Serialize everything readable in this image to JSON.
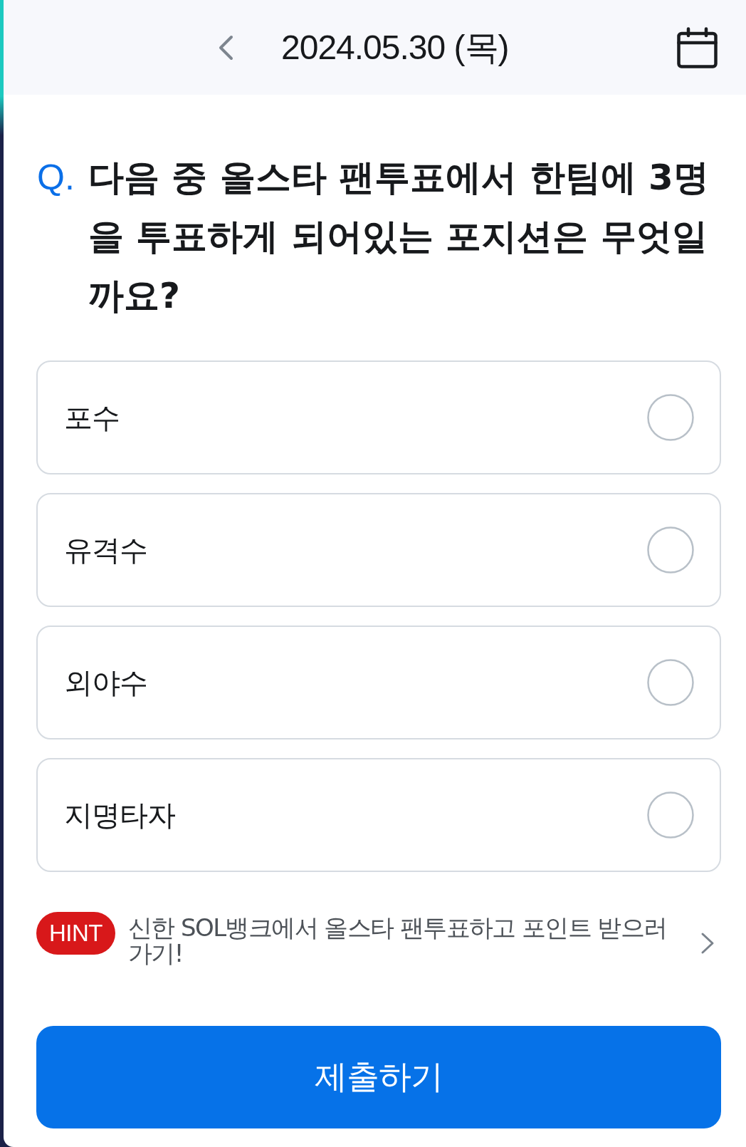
{
  "header": {
    "date": "2024.05.30 (목)"
  },
  "question": {
    "marker": "Q.",
    "text": "다음 중 올스타 팬투표에서 한팀에 3명을 투표하게 되어있는 포지션은 무엇일까요?"
  },
  "options": [
    {
      "label": "포수",
      "selected": false
    },
    {
      "label": "유격수",
      "selected": false
    },
    {
      "label": "외야수",
      "selected": false
    },
    {
      "label": "지명타자",
      "selected": false
    }
  ],
  "hint": {
    "badge": "HINT",
    "text": "신한 SOL뱅크에서 올스타 팬투표하고 포인트 받으러 가기!"
  },
  "submit_button": {
    "label": "제출하기"
  }
}
